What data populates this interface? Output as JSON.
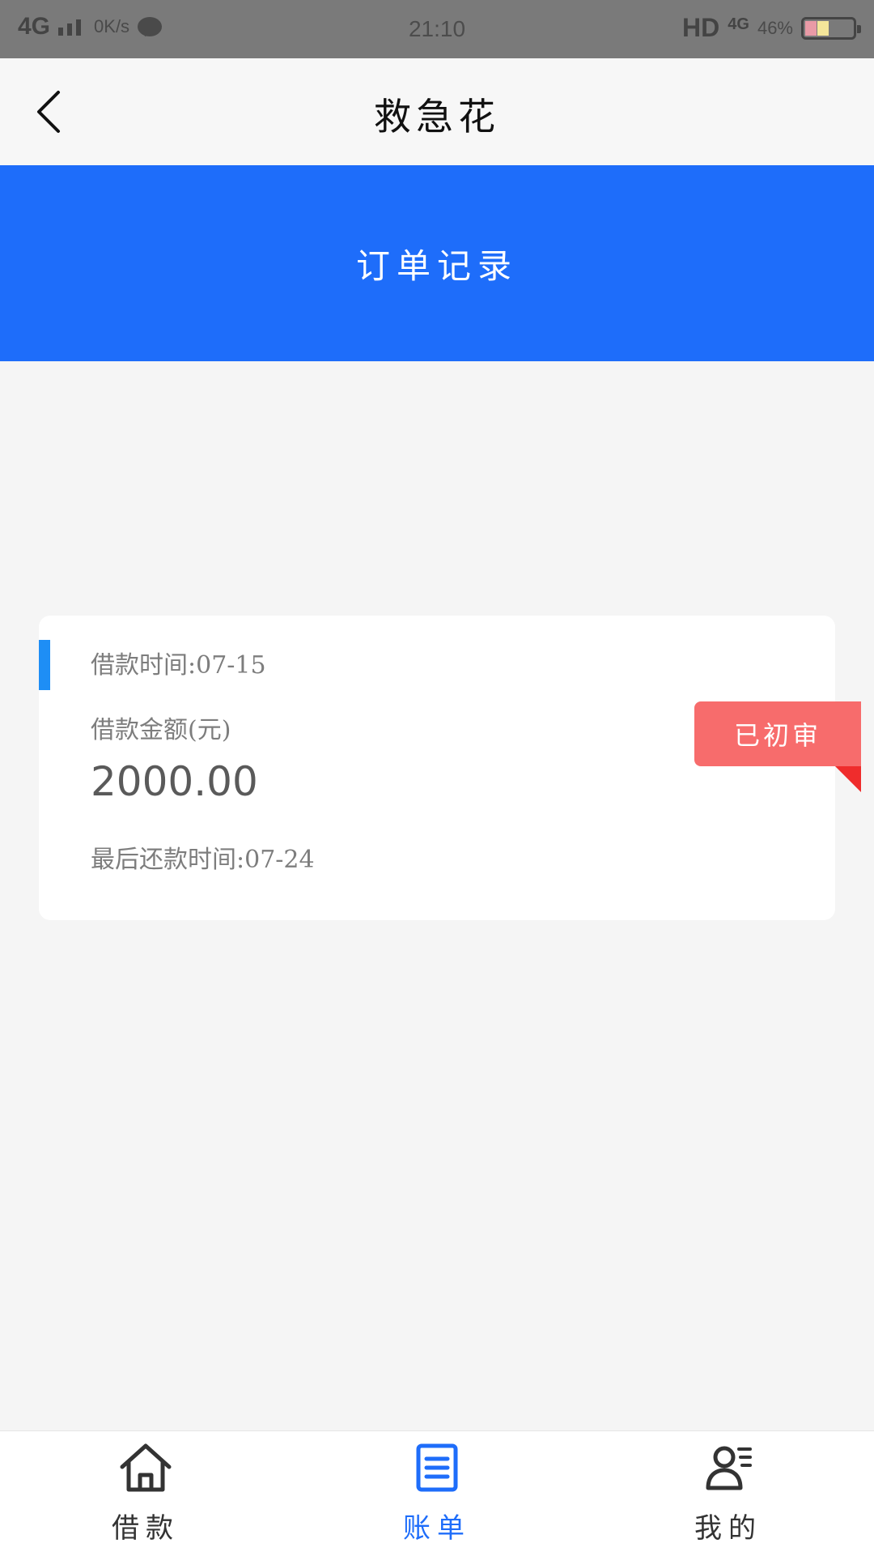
{
  "status_bar": {
    "network": "4G",
    "speed": "0K/s",
    "time": "21:10",
    "hd": "HD",
    "network_right": "4G",
    "battery_pct": "46%"
  },
  "header": {
    "title": "救急花"
  },
  "banner": {
    "title": "订单记录"
  },
  "order": {
    "loan_time": "借款时间:07-15",
    "amount_label": "借款金额(元)",
    "amount": "2000.00",
    "last_repay": "最后还款时间:07-24",
    "status": "已初审"
  },
  "nav": {
    "items": [
      {
        "label": "借款",
        "icon": "home-icon",
        "active": false
      },
      {
        "label": "账单",
        "icon": "bill-icon",
        "active": true
      },
      {
        "label": "我的",
        "icon": "profile-icon",
        "active": false
      }
    ]
  },
  "colors": {
    "primary": "#1e6dfa",
    "status_ribbon": "#f76c6c",
    "accent_bar": "#1e8ef5"
  }
}
